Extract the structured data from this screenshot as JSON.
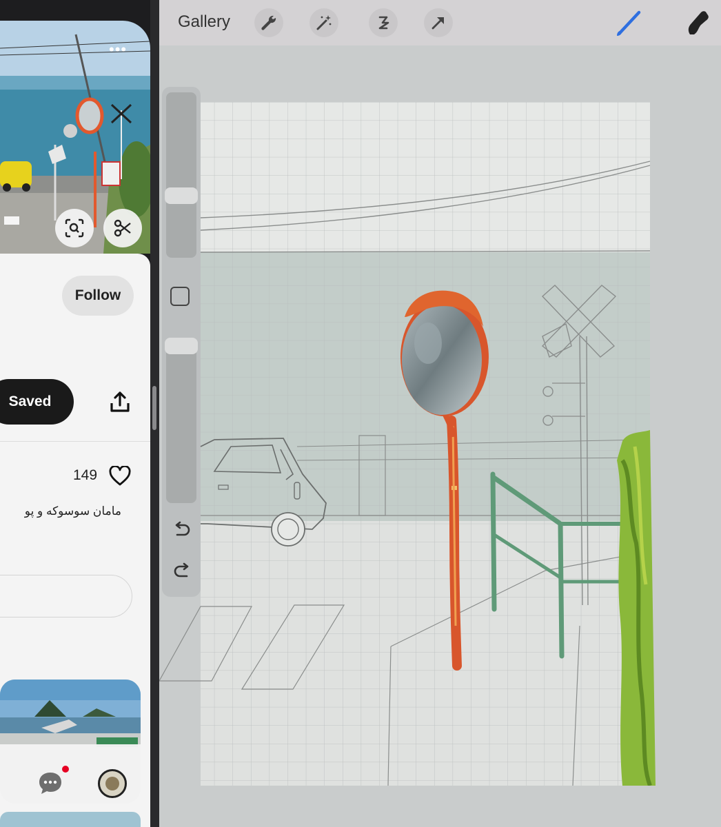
{
  "pin_app": {
    "more_icon": "more-horizontal-icon",
    "lens_icon": "visual-search-icon",
    "cutout_icon": "scissors-icon",
    "follow_label": "Follow",
    "saved_label": "Saved",
    "share_icon": "share-icon",
    "like_count": "149",
    "heart_icon": "heart-icon",
    "description": "مامان سوسوکه و پو",
    "nav": {
      "messages_icon": "chat-bubble-icon",
      "has_notification": true,
      "profile_icon": "avatar"
    }
  },
  "drawing_app": {
    "gallery_label": "Gallery",
    "tools": [
      "wrench-icon",
      "magic-wand-icon",
      "selection-icon",
      "transform-arrow-icon",
      "brush-icon",
      "smudge-icon"
    ],
    "accent_color": "#2f6fe0",
    "sidebar": {
      "modify_icon": "square-icon",
      "undo_icon": "undo-icon",
      "redo_icon": "redo-icon"
    }
  }
}
